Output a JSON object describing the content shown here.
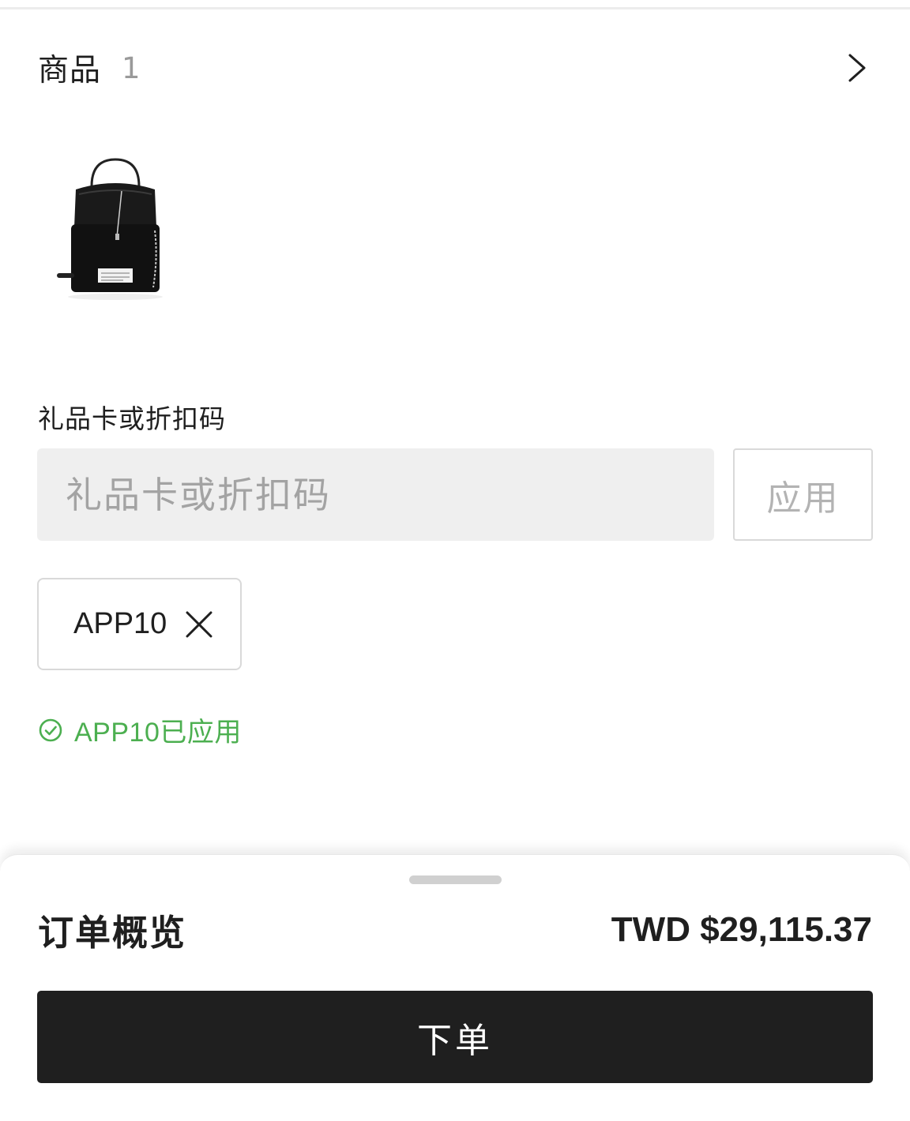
{
  "products": {
    "title": "商品",
    "count": "1",
    "items": [
      {
        "image_icon": "bucket-bag-product-image"
      }
    ]
  },
  "promo": {
    "label": "礼品卡或折扣码",
    "placeholder": "礼品卡或折扣码",
    "value": "",
    "apply_label": "应用",
    "applied_code": "APP10",
    "applied_message": "APP10已应用"
  },
  "summary": {
    "title": "订单概览",
    "total": "TWD $29,115.37",
    "place_order_label": "下单"
  },
  "colors": {
    "accent_dark": "#1f1f1f",
    "success_green": "#4caf50",
    "input_bg": "#efefef",
    "muted_text": "#a3a3a3"
  }
}
